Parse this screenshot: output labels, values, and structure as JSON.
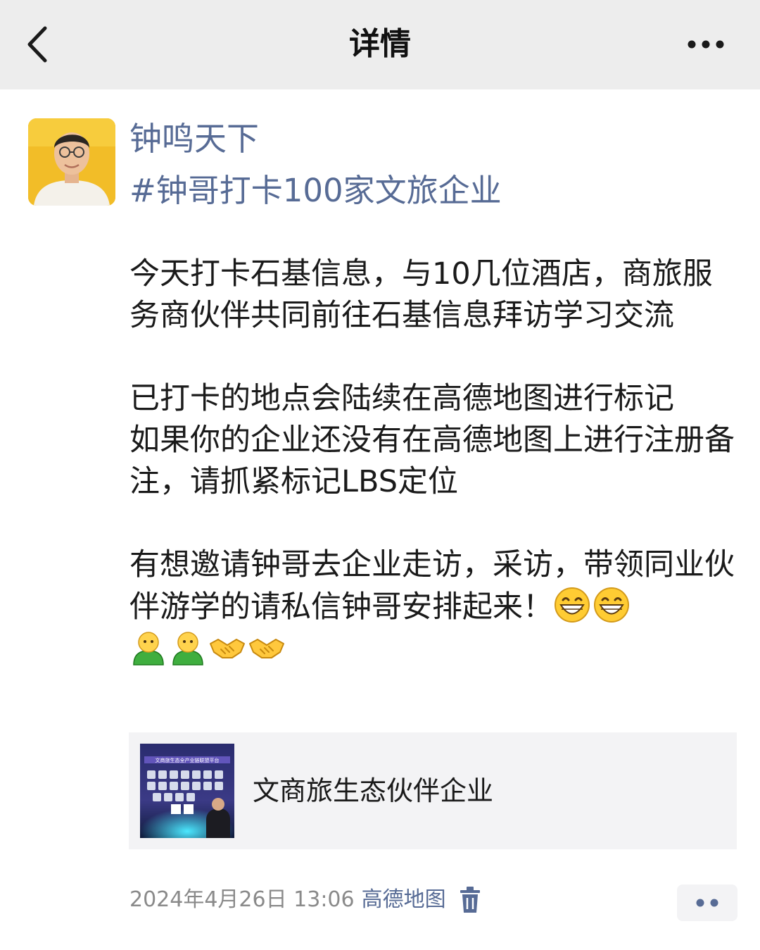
{
  "header": {
    "title": "详情",
    "back_icon": "chevron-left-icon",
    "more_icon": "more-dots-icon"
  },
  "post": {
    "author": "钟鸣天下",
    "hashtag": "#钟哥打卡100家文旅企业",
    "paragraphs": [
      "今天打卡石基信息，与10几位酒店，商旅服务商伙伴共同前往石基信息拜访学习交流",
      "已打卡的地点会陆续在高德地图进行标记\n如果你的企业还没有在高德地图上进行注册备注，请抓紧标记LBS定位",
      "有想邀请钟哥去企业走访，采访，带领同业伙伴游学的请私信钟哥安排起来！"
    ],
    "emojis": [
      "grin-emoji",
      "grin-emoji",
      "person-emoji",
      "person-emoji",
      "handshake-emoji",
      "handshake-emoji"
    ],
    "link": {
      "title": "文商旅生态伙伴企业",
      "thumbnail_title": "文商旅生态全产业链联盟平台"
    },
    "meta": {
      "time": "2024年4月26日 13:06",
      "location": "高德地图"
    }
  },
  "colors": {
    "link_blue": "#576b95",
    "header_bg": "#ededed",
    "card_bg": "#f3f3f5",
    "meta_gray": "#8a8a8a"
  }
}
